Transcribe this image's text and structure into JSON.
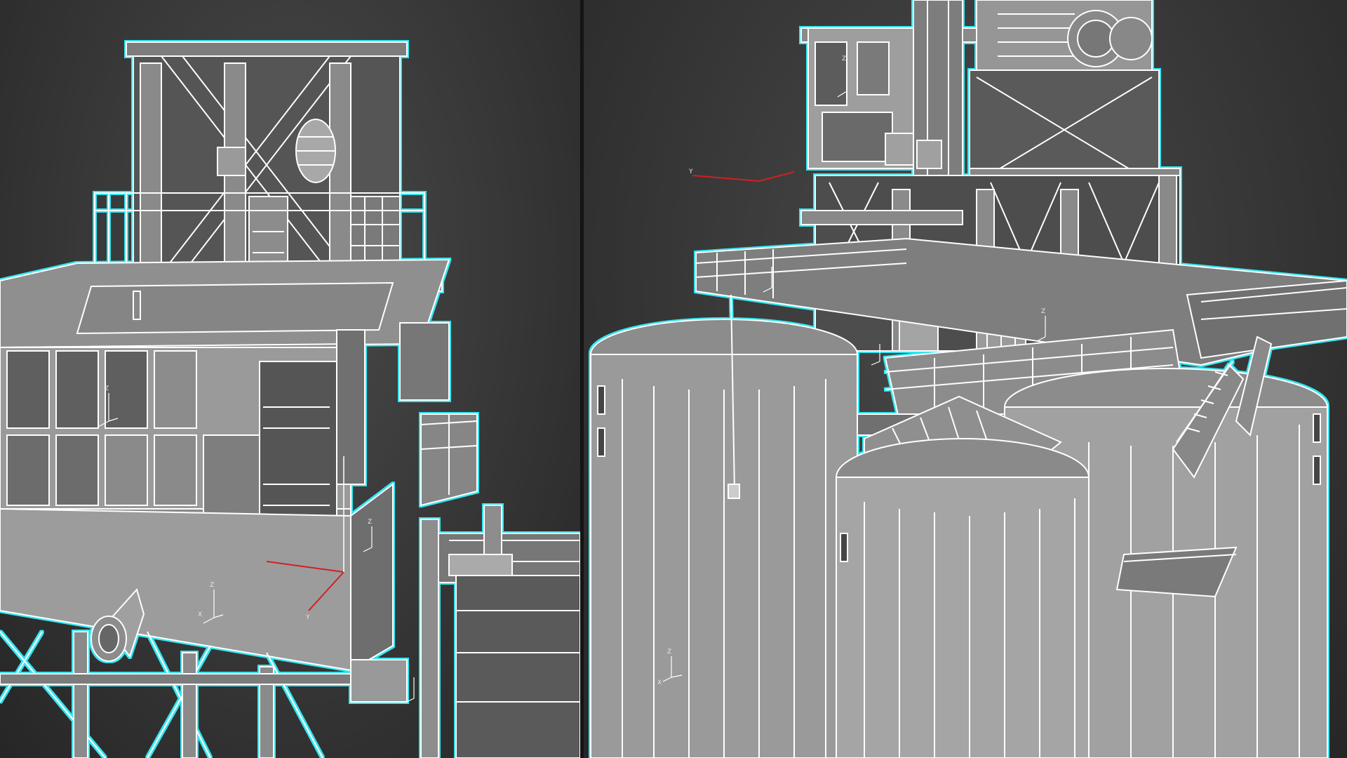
{
  "viewports": {
    "left": {
      "view": "perspective-wireframe-shaded"
    },
    "right": {
      "view": "perspective-wireframe-shaded"
    }
  },
  "gizmo_axes": {
    "x": "X",
    "y": "Y",
    "z": "Z"
  },
  "colors": {
    "background_dark": "#262626",
    "background_light": "#4a4a4a",
    "selection_outline": "#32e6f0",
    "wire": "#ffffff",
    "surface": "#9a9a9a",
    "surface_dark": "#707070",
    "axis_x": "#d22020"
  }
}
